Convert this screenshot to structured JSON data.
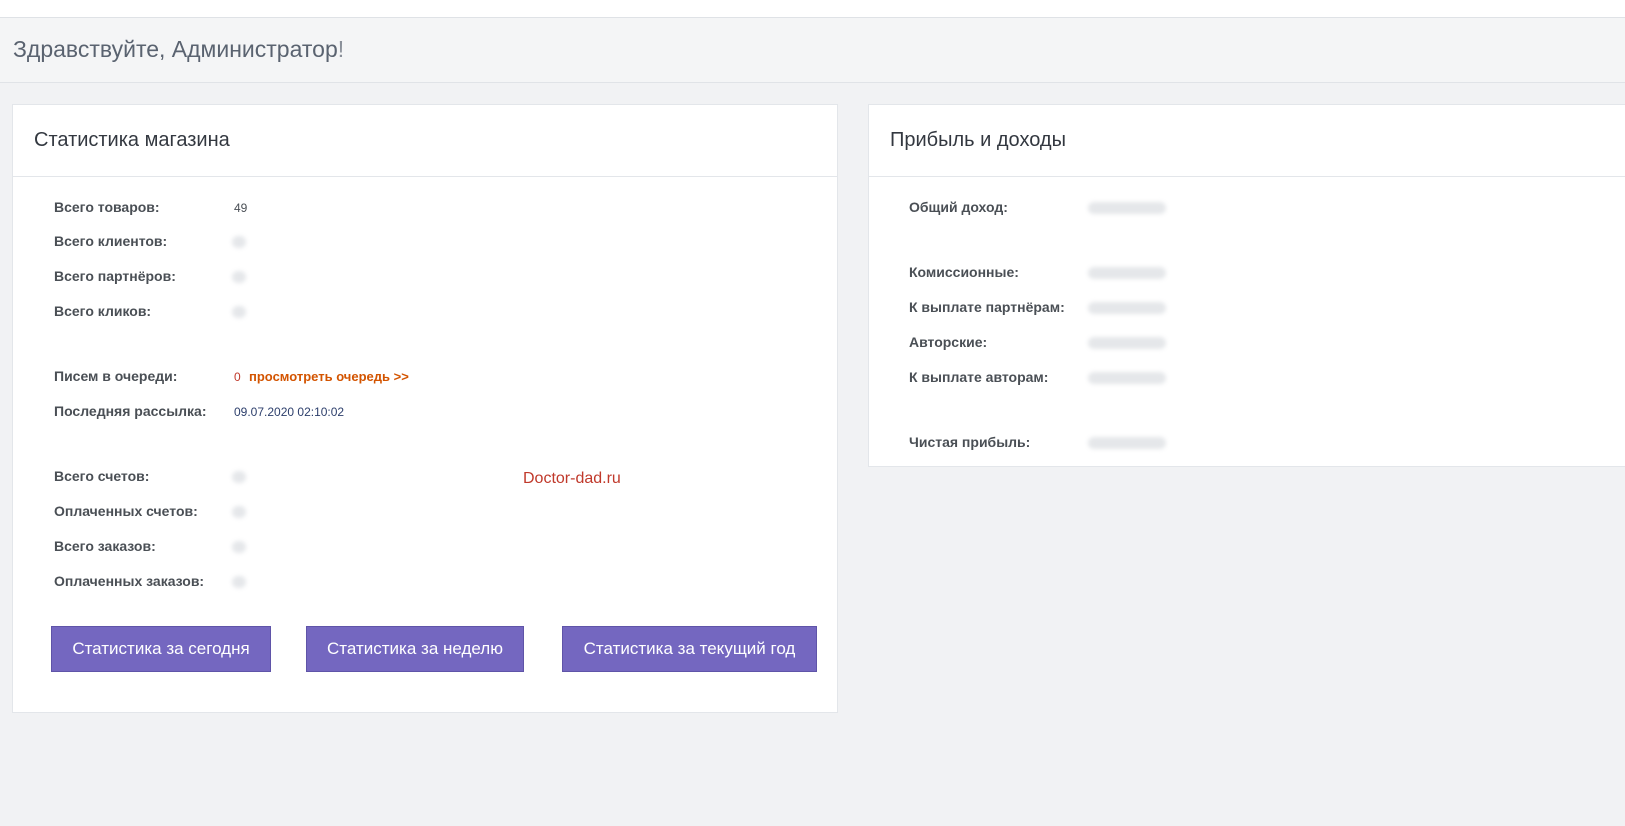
{
  "greeting": {
    "text": "Здравствуйте, Администратор",
    "exclamation": "!"
  },
  "shop_stats": {
    "title": "Статистика магазина",
    "rows": [
      {
        "label": "Всего товаров:",
        "value": "49"
      },
      {
        "label": "Всего клиентов:"
      },
      {
        "label": "Всего партнёров:"
      },
      {
        "label": "Всего кликов:"
      },
      {
        "label": "Писем в очереди:",
        "value": "0"
      },
      {
        "label": "Последняя рассылка:",
        "value": "09.07.2020 02:10:02"
      },
      {
        "label": "Всего счетов:"
      },
      {
        "label": "Оплаченных счетов:"
      },
      {
        "label": "Всего заказов:"
      },
      {
        "label": "Оплаченных заказов:"
      }
    ],
    "queue_link": "просмотреть очередь >>",
    "watermark": "Doctor-dad.ru",
    "buttons": {
      "today": "Статистика за сегодня",
      "week": "Статистика за неделю",
      "year": "Статистика за текущий год"
    }
  },
  "profit": {
    "title": "Прибыль и доходы",
    "rows": [
      {
        "label": "Общий доход:"
      },
      {
        "label": "Комиссионные:"
      },
      {
        "label": "К выплате партнёрам:"
      },
      {
        "label": "Авторские:"
      },
      {
        "label": "К выплате авторам:"
      },
      {
        "label": "Чистая прибыль:"
      }
    ]
  },
  "colors": {
    "button": "#7467c0",
    "link": "#d35400",
    "watermark": "#c0392b",
    "background": "#f1f2f4"
  }
}
